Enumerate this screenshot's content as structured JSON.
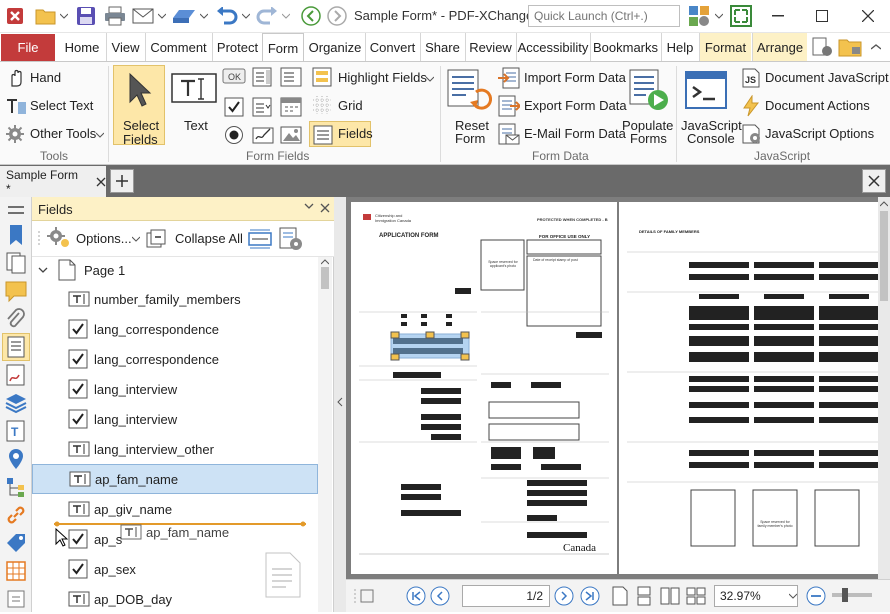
{
  "titlebar": {
    "title": "Sample Form* - PDF-XChange ...",
    "quick_launch_placeholder": "Quick Launch (Ctrl+.)"
  },
  "ribbon_tabs": {
    "file": "File",
    "tabs": [
      "Home",
      "View",
      "Comment",
      "Protect",
      "Form",
      "Organize",
      "Convert",
      "Share",
      "Review",
      "Accessibility",
      "Bookmarks",
      "Help",
      "Format",
      "Arrange"
    ],
    "active": "Form"
  },
  "ribbon": {
    "tools": {
      "hand": "Hand",
      "select_text": "Select Text",
      "other_tools": "Other Tools",
      "group": "Tools"
    },
    "form_fields": {
      "select_fields_1": "Select",
      "select_fields_2": "Fields",
      "text": "Text",
      "highlight_fields": "Highlight Fields",
      "grid": "Grid",
      "fields": "Fields",
      "group": "Form Fields"
    },
    "form_data": {
      "reset_1": "Reset",
      "reset_2": "Form",
      "import": "Import Form Data",
      "export": "Export Form Data",
      "email": "E-Mail Form Data",
      "populate_1": "Populate",
      "populate_2": "Forms",
      "group": "Form Data"
    },
    "javascript": {
      "console_1": "JavaScript",
      "console_2": "Console",
      "doc_js": "Document JavaScript",
      "doc_actions": "Document Actions",
      "js_options": "JavaScript Options",
      "group": "JavaScript"
    }
  },
  "doc_tab": {
    "label": "Sample Form *"
  },
  "fields_pane": {
    "title": "Fields",
    "options_label": "Options...",
    "collapse_all": "Collapse All",
    "page_label": "Page 1",
    "items": [
      {
        "name": "number_family_members",
        "type": "text"
      },
      {
        "name": "lang_correspondence",
        "type": "checkbox"
      },
      {
        "name": "lang_correspondence",
        "type": "checkbox"
      },
      {
        "name": "lang_interview",
        "type": "checkbox"
      },
      {
        "name": "lang_interview",
        "type": "checkbox"
      },
      {
        "name": "lang_interview_other",
        "type": "text"
      },
      {
        "name": "ap_fam_name",
        "type": "text",
        "selected": true
      },
      {
        "name": "ap_giv_name",
        "type": "text"
      },
      {
        "name": "ap_s",
        "type": "checkbox"
      },
      {
        "name": "ap_sex",
        "type": "checkbox"
      },
      {
        "name": "ap_DOB_day",
        "type": "text"
      }
    ],
    "drag_label": "ap_fam_name"
  },
  "document": {
    "page1": {
      "header_left_1": "Citizenship and",
      "header_left_2": "Immigration Canada",
      "header_right_1": "PROTECTED WHEN COMPLETED - B",
      "title": "APPLICATION FORM",
      "office_use": "FOR OFFICE USE ONLY",
      "photo_label": "Space reserved for applicant's photo",
      "stamp_label": "Date of receipt stamp of post",
      "canada": "Canada"
    },
    "page2": {
      "header": "DETAILS OF FAMILY MEMBERS",
      "photo_label": "Space reserved for family member's photo"
    }
  },
  "bottom_bar": {
    "page_value": "1/2",
    "zoom_value": "32.97%"
  },
  "colors": {
    "accent": "#c33b3b",
    "context_tab": "#fdf1c6",
    "selection": "#cde2f5",
    "drag_line": "#e39a2a"
  }
}
